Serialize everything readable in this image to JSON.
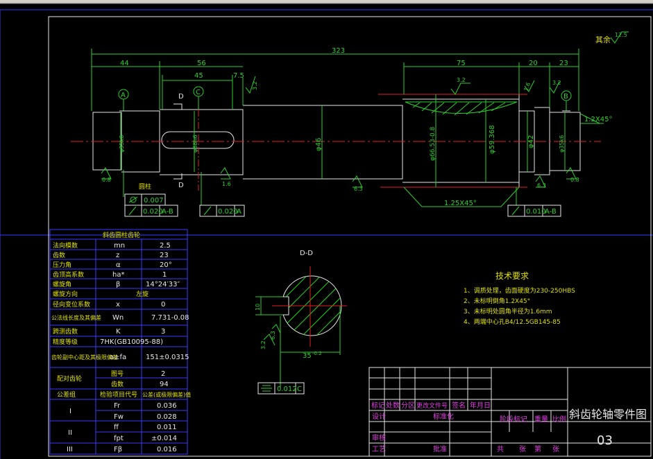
{
  "surface": {
    "finish": "其余",
    "finish_value": "12.5"
  },
  "dims": {
    "total": "323",
    "d44": "44",
    "d56": "56",
    "d45": "45",
    "d75a": "7.5",
    "d75": "75",
    "d20": "20",
    "d23": "23",
    "chamfer_r": "1.2X45°",
    "phi35a": "φ35k6",
    "phi38": "φ38h6",
    "phi46": "φ46",
    "phi66": "φ66.53-0.8",
    "phi59": "φ59.368",
    "phi42": "φ42",
    "phi35b": "φ35k6",
    "chamfer_bot": "1.25X45°"
  },
  "labels": {
    "A": "A",
    "B": "B",
    "C": "C",
    "D1": "D",
    "D2": "D",
    "DD": "D-D"
  },
  "roughness": {
    "r32a": "3.2",
    "r32b": "3.2",
    "r16": "1.6",
    "r32c": "3.2",
    "r08a": "0.8",
    "r16b": "1.6",
    "r63": "6.3",
    "r63b": "6.3",
    "r08b": "0.8",
    "r32d": "3.2",
    "r63c": "6.3"
  },
  "tolerance": {
    "cyl": {
      "value": "0.007"
    },
    "run1": {
      "value": "0.020",
      "datum": "A-B"
    },
    "run2": {
      "value": "0.020",
      "datum": "A"
    },
    "run3": {
      "value": "0.010",
      "datum": "A-B"
    },
    "sym": {
      "value": "0.012",
      "datum": "C"
    },
    "cyl_note": "圆柱"
  },
  "section": {
    "w": "10",
    "t": "35",
    "t_tol": "-0.2"
  },
  "tech": {
    "title": "技术要求",
    "items": [
      "1、调质处理，齿面硬度为230-250HBS",
      "2、未标明倒角1.2X45°",
      "3、未标明处圆角半径为1.6mm",
      "4、两端中心孔B4/12.5GB145-85"
    ]
  },
  "params": {
    "title": "斜齿圆柱齿轮",
    "rows": [
      [
        "法向模数",
        "mn",
        "2.5"
      ],
      [
        "齿数",
        "z",
        "23"
      ],
      [
        "压力角",
        "α",
        "20°"
      ],
      [
        "齿顶高系数",
        "ha*",
        "1"
      ],
      [
        "螺旋角",
        "β",
        "14°24′33″"
      ],
      [
        "螺旋方向",
        "左旋",
        ""
      ],
      [
        "径向变位系数",
        "x",
        "0"
      ],
      [
        "公法线长度及其偏差",
        "Wn",
        "7.731-0.08"
      ],
      [
        "跨测齿数",
        "K",
        "3"
      ],
      [
        "精度等级",
        "7HK(GB10095-88)",
        ""
      ],
      [
        "齿轮副中心距及其极限偏差",
        "a±fa",
        "151±0.0315"
      ]
    ],
    "mate": {
      "label": "配对齿轮",
      "r1": [
        "图号",
        "2"
      ],
      "r2": [
        "齿数",
        "94"
      ]
    },
    "grp": {
      "h": [
        "公差组",
        "检验项目代号",
        "公差(或极限偏差)值"
      ]
    },
    "g1": {
      "label": "I",
      "rows": [
        [
          "Fr",
          "0.036"
        ],
        [
          "Fw",
          "0.028"
        ]
      ]
    },
    "g2": {
      "label": "II",
      "rows": [
        [
          "ff",
          "0.011"
        ],
        [
          "fpt",
          "±0.014"
        ]
      ]
    },
    "g3": {
      "label": "III",
      "rows": [
        [
          "Fβ",
          "0.016"
        ]
      ]
    }
  },
  "title_block": {
    "name": "斜齿轮轴零件图",
    "drawing_no": "03",
    "c1": "标记",
    "c2": "处数",
    "c3": "分区",
    "c4": "更改文件号",
    "c5": "签名",
    "c6": "年月日",
    "c7": "设计",
    "c8": "标准化",
    "c9": "阶段标记",
    "c10": "重量",
    "c11": "比例",
    "c12": "审核",
    "c13": "工艺",
    "c14": "批准",
    "c15": "共",
    "c16": "张",
    "c17": "第",
    "c18": "张"
  }
}
